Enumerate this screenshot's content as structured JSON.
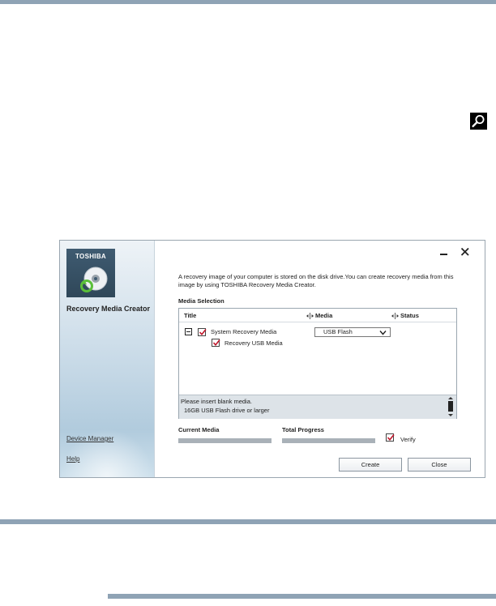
{
  "window": {
    "brand": "TOSHIBA",
    "app_name": "Recovery Media Creator",
    "description": "A recovery image of your computer is stored on the disk drive.You can create recovery media from this image by using TOSHIBA Recovery Media Creator."
  },
  "sidebar": {
    "links": [
      {
        "label": "Device Manager"
      },
      {
        "label": "Help"
      }
    ]
  },
  "media_selection": {
    "title": "Media Selection",
    "columns": [
      "Title",
      "Media",
      "Status"
    ],
    "rows": [
      {
        "label": "System Recovery Media",
        "checked": true,
        "media": "USB Flash",
        "status": ""
      },
      {
        "label": "Recovery USB Media",
        "checked": true
      }
    ],
    "info_lines": [
      "Please insert blank media.",
      "16GB USB Flash drive or larger"
    ]
  },
  "progress": {
    "current_label": "Current Media",
    "total_label": "Total Progress",
    "current_value": 0,
    "total_value": 0
  },
  "verify": {
    "label": "Verify",
    "checked": true
  },
  "buttons": {
    "create": "Create",
    "close": "Close"
  },
  "colors": {
    "page_rule": "#8fa3b5",
    "checkmark": "#c0182c",
    "logo_bg": "#3f5b71",
    "progress_track": "#a9b1b8"
  },
  "icons": {
    "zoom": "magnifier-icon",
    "disc": "disc-recovery-icon",
    "close": "close-icon",
    "minimize": "minimize-icon"
  }
}
